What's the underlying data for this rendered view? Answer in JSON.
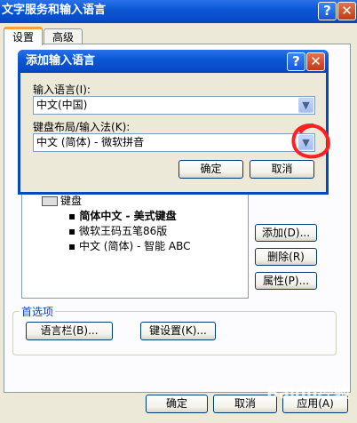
{
  "outer_window": {
    "title": "文字服务和输入语言",
    "help_glyph": "?",
    "close_glyph": "✕",
    "tabs": [
      {
        "label": "设置",
        "active": true
      },
      {
        "label": "高级",
        "active": false
      }
    ],
    "installed_services": {
      "keyboard_label": "键盘",
      "items": [
        "简体中文 - 美式键盘",
        "微软王码五笔86版",
        "中文 (简体) - 智能 ABC"
      ]
    },
    "side_buttons": {
      "add": "添加(D)...",
      "remove": "删除(R)",
      "properties": "属性(P)..."
    },
    "preferences": {
      "legend": "首选项",
      "language_bar_button": "语言栏(B)...",
      "key_settings_button": "键设置(K)..."
    },
    "bottom_buttons": {
      "ok": "确定",
      "cancel": "取消",
      "apply": "应用(A)"
    }
  },
  "dialog": {
    "title": "添加输入语言",
    "help_glyph": "?",
    "close_glyph": "✕",
    "input_language_label": "输入语言(I):",
    "input_language_value": "中文(中国)",
    "keyboard_layout_label": "键盘布局/输入法(K):",
    "keyboard_layout_value": "中文 (简体) - 微软拼音",
    "ok_button": "确定",
    "cancel_button": "取消"
  },
  "watermark": "Baidu经验",
  "colors": {
    "title_bar": "#0c58d6",
    "annotation_circle": "#ff2020",
    "window_bg": "#ece9d8"
  }
}
